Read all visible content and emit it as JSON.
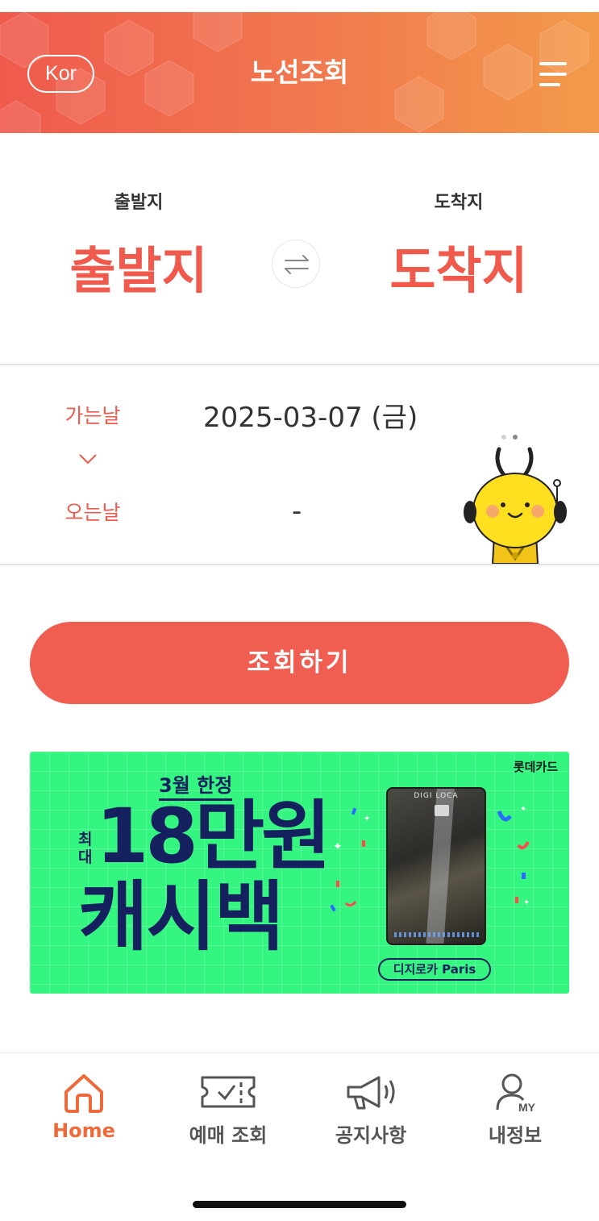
{
  "header": {
    "lang_label": "Kor",
    "title": "노선조회",
    "menu_icon": "hamburger-menu-icon",
    "gradient": [
      "#ef5a4d",
      "#f39a4a"
    ]
  },
  "route": {
    "origin_label": "출발지",
    "origin_value": "출발지",
    "destination_label": "도착지",
    "destination_value": "도착지",
    "swap_icon": "swap-arrows-icon"
  },
  "dates": {
    "depart_label": "가는날",
    "depart_value": "2025-03-07 (금)",
    "return_label": "오는날",
    "return_value": "-"
  },
  "search_button": {
    "label": "조회하기",
    "color": "#f05e51"
  },
  "banner": {
    "brand": "롯데카드",
    "limited_text": "3월 한정",
    "max_text": "최대",
    "amount_text": "18만원",
    "cashback_text": "캐시백",
    "card_name": "DIGI LOCA",
    "card_label": "디지로카 Paris",
    "background": "#33f57f"
  },
  "bottom_nav": {
    "items": [
      {
        "label": "Home",
        "icon": "home-icon",
        "active": true
      },
      {
        "label": "예매 조회",
        "icon": "ticket-check-icon",
        "active": false
      },
      {
        "label": "공지사항",
        "icon": "megaphone-icon",
        "active": false
      },
      {
        "label": "내정보",
        "icon": "user-my-icon",
        "active": false
      }
    ],
    "active_color": "#ef6a3a"
  }
}
